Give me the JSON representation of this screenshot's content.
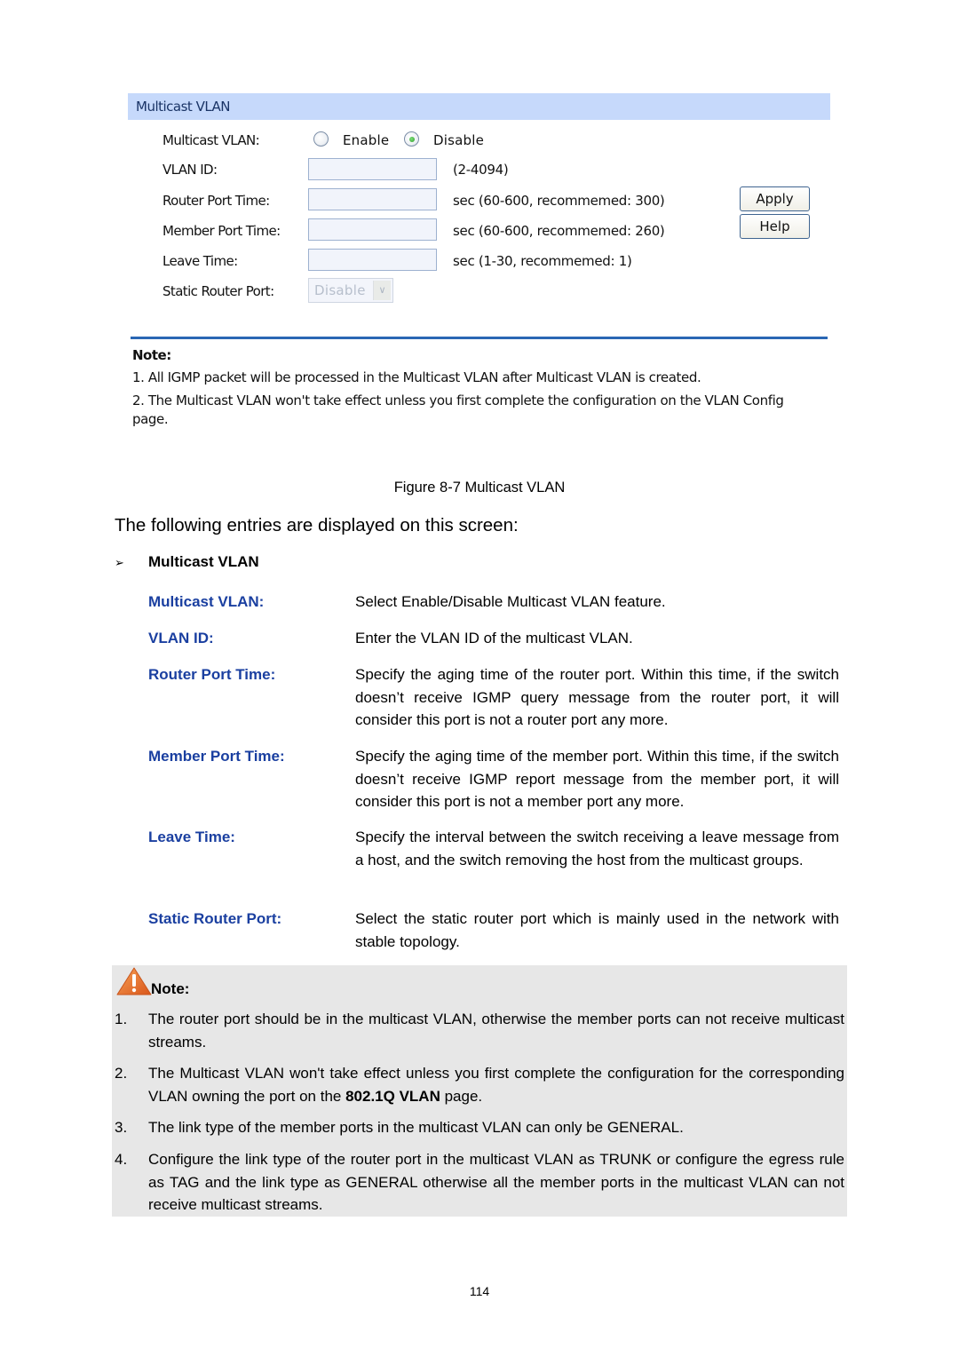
{
  "figure": {
    "panel_title": "Multicast VLAN",
    "fields": {
      "multicast_vlan": {
        "label": "Multicast VLAN:",
        "options": [
          "Enable",
          "Disable"
        ],
        "selected": "Disable"
      },
      "vlan_id": {
        "label": "VLAN ID:",
        "value": "",
        "hint": "(2-4094)"
      },
      "router_port_time": {
        "label": "Router Port Time:",
        "value": "",
        "hint": "sec (60-600, recommemed: 300)"
      },
      "member_port_time": {
        "label": "Member Port Time:",
        "value": "",
        "hint": "sec (60-600, recommemed: 260)"
      },
      "leave_time": {
        "label": "Leave Time:",
        "value": "",
        "hint": "sec (1-30, recommemed: 1)"
      },
      "static_router_port": {
        "label": "Static Router Port:",
        "selected": "Disable",
        "disabled": true
      }
    },
    "buttons": {
      "apply": "Apply",
      "help": "Help"
    },
    "note": {
      "title": "Note:",
      "lines": [
        "1. All IGMP packet will be processed in the Multicast VLAN after Multicast VLAN is created.",
        "2. The Multicast VLAN won't take effect unless you first complete the configuration on the VLAN Config page."
      ]
    }
  },
  "caption": "Figure 8-7 Multicast VLAN",
  "intro": "The following entries are displayed on this screen:",
  "section": {
    "bullet": "➢",
    "title": "Multicast VLAN"
  },
  "entries": [
    {
      "term": "Multicast VLAN:",
      "desc": "Select Enable/Disable Multicast VLAN feature."
    },
    {
      "term": "VLAN ID:",
      "desc": "Enter the VLAN ID of the multicast VLAN."
    },
    {
      "term": "Router Port Time:",
      "desc": "Specify the aging time of the router port. Within this time, if the switch doesn’t receive IGMP query message from the router port, it will consider this port is not a router port any more."
    },
    {
      "term": "Member Port Time:",
      "desc": "Specify the aging time of the member port. Within this time, if the switch doesn’t receive IGMP report message from the member port, it will consider this port is not a member port any more."
    },
    {
      "term": "Leave Time:",
      "desc": "Specify the interval between the switch receiving a leave message from a host, and the switch removing the host from the multicast groups."
    },
    {
      "term": "Static Router Port:",
      "desc": "Select the static router port which is mainly used in the network with stable topology."
    }
  ],
  "note": {
    "icon": "warning-icon",
    "title": "Note:",
    "items": [
      {
        "num": "1.",
        "text": "The router port should be in the multicast VLAN, otherwise the member ports can not receive multicast streams."
      },
      {
        "num": "2.",
        "text_before": "The Multicast VLAN won't take effect unless you first complete the configuration for the corresponding VLAN owning the port on the ",
        "text_bold": "802.1Q VLAN",
        "text_after": " page."
      },
      {
        "num": "3.",
        "text": "The link type of the member ports in the multicast VLAN can only be GENERAL."
      },
      {
        "num": "4.",
        "text": "Configure the link type of the router port in the multicast VLAN as TRUNK or configure the egress rule as TAG and the link type as GENERAL otherwise all the member ports in the multicast VLAN can not receive multicast streams."
      }
    ]
  },
  "page_number": "114",
  "colors": {
    "panel_header_bg": "#c6d9fb",
    "term_blue": "#1a3fa0",
    "divider_blue": "#2a67b4",
    "note_bg": "#e7e7e7",
    "warning_orange": "#e8731f"
  }
}
